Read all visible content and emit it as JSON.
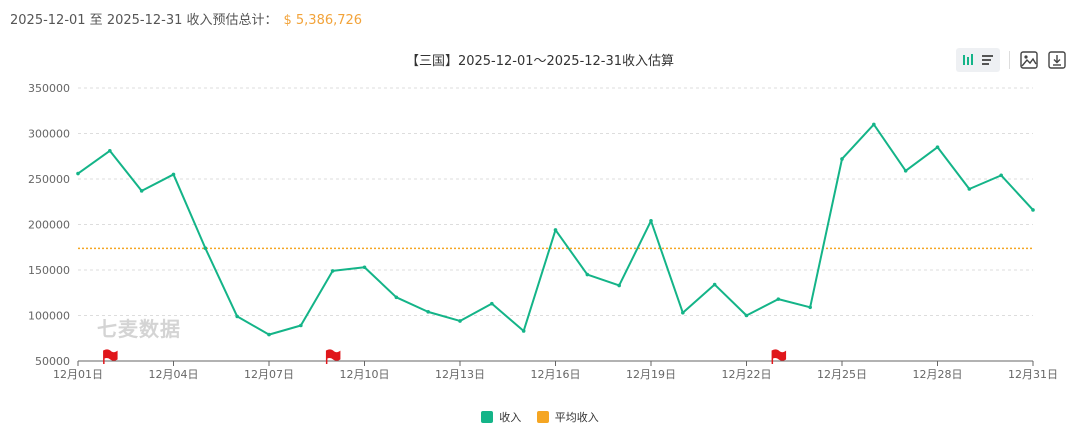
{
  "summary": {
    "date_range": "2025-12-01 至 2025-12-31 收入预估总计：",
    "total": "$ 5,386,726"
  },
  "watermark": "七麦数据",
  "toolbar": {
    "icons": [
      "bar-chart-icon",
      "list-icon",
      "save-image-icon",
      "download-icon"
    ]
  },
  "colors": {
    "revenue": "#14b488",
    "average": "#f5a623",
    "flag": "#e0161b",
    "grid": "#dddddd"
  },
  "chart_data": {
    "type": "line",
    "title": "【三国】2025-12-01～2025-12-31收入估算",
    "ylim": [
      50000,
      350000
    ],
    "yticks": [
      50000,
      100000,
      150000,
      200000,
      250000,
      300000,
      350000
    ],
    "ytick_labels": [
      "50000",
      "100000",
      "150000",
      "200000",
      "250000",
      "300000",
      "350000"
    ],
    "x": [
      "12月01日",
      "12月02日",
      "12月03日",
      "12月04日",
      "12月05日",
      "12月06日",
      "12月07日",
      "12月08日",
      "12月09日",
      "12月10日",
      "12月11日",
      "12月12日",
      "12月13日",
      "12月14日",
      "12月15日",
      "12月16日",
      "12月17日",
      "12月18日",
      "12月19日",
      "12月20日",
      "12月21日",
      "12月22日",
      "12月23日",
      "12月24日",
      "12月25日",
      "12月26日",
      "12月27日",
      "12月28日",
      "12月29日",
      "12月30日",
      "12月31日"
    ],
    "xtick_labels": [
      "12月01日",
      "12月04日",
      "12月07日",
      "12月10日",
      "12月13日",
      "12月16日",
      "12月19日",
      "12月22日",
      "12月25日",
      "12月28日",
      "12月31日"
    ],
    "series": [
      {
        "name": "收入",
        "values": [
          256000,
          281000,
          237000,
          255000,
          174000,
          99000,
          79000,
          89000,
          149000,
          153000,
          120000,
          104000,
          94000,
          113000,
          83000,
          194000,
          145000,
          133000,
          204000,
          103000,
          134000,
          100000,
          118000,
          109000,
          272000,
          310000,
          259000,
          285000,
          239000,
          254000,
          216000
        ]
      },
      {
        "name": "平均收入",
        "value": 173765,
        "style": "dotted"
      }
    ],
    "flags_at": [
      1.0,
      8.0,
      22.0
    ],
    "legend": [
      "收入",
      "平均收入"
    ],
    "legend_position": "bottom-center",
    "grid": true
  }
}
